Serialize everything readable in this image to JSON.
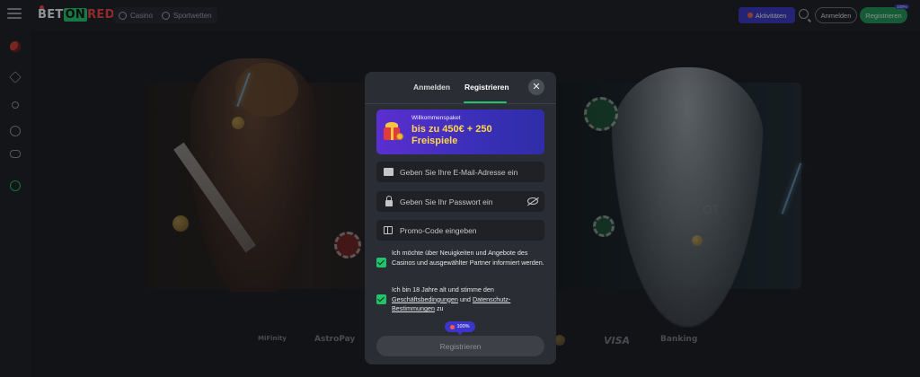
{
  "header": {
    "logo": {
      "part1": "BET",
      "part2": "ON",
      "part3": "RED"
    },
    "nav": [
      {
        "label": "Casino",
        "icon": "casino-icon"
      },
      {
        "label": "Sportwetten",
        "icon": "sports-icon"
      }
    ],
    "activities_label": "Aktivitäten",
    "login_label": "Anmelden",
    "register_label": "Registrieren",
    "register_badge": "100%"
  },
  "sidebar": {
    "icons": [
      "roulette-icon",
      "network-icon",
      "live-broadcast-icon",
      "football-icon",
      "gamepad-icon",
      "esports-icon"
    ]
  },
  "hero": {
    "partial_text": "OT"
  },
  "payments": [
    "MiFinity",
    "AstroPay",
    "VISA",
    "Banking"
  ],
  "modal": {
    "tabs": [
      {
        "label": "Anmelden",
        "active": false
      },
      {
        "label": "Registrieren",
        "active": true
      }
    ],
    "close_icon": "close-icon",
    "promo": {
      "small": "Willkommenspaket",
      "big": "bis zu 450€ + 250 Freispiele"
    },
    "fields": {
      "email_placeholder": "Geben Sie Ihre E-Mail-Adresse ein",
      "password_placeholder": "Geben Sie Ihr Passwort ein",
      "promo_placeholder": "Promo-Code eingeben"
    },
    "consents": {
      "newsletter": "Ich möchte über Neuigkeiten und Angebote des Casinos und ausgewählter Partner informiert werden.",
      "terms_prefix": "Ich bin 18 Jahre alt und stimme den",
      "terms_link": "Geschäftsbedingungen",
      "terms_and": "und",
      "privacy_link": "Datenschutz-Bestimmungen",
      "terms_suffix": "zu"
    },
    "progress_badge": "100%",
    "submit_label": "Registrieren"
  },
  "colors": {
    "accent_green": "#20c46a",
    "accent_purple": "#3b35c9",
    "brand_red": "#ff4242",
    "modal_bg": "#2a2d33"
  }
}
